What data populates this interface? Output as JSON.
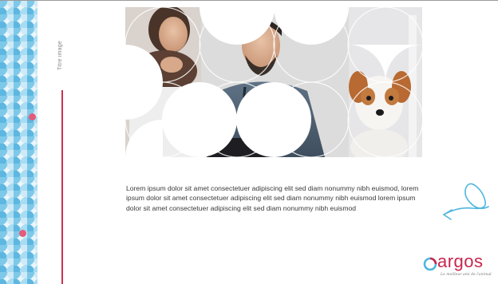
{
  "slide": {
    "image_title_label": "Titre image",
    "body_text": "Lorem ipsum dolor sit amet consectetuer adipiscing elit sed diam nonummy nibh euismod, lorem ipsum dolor sit amet consectetuer adipiscing elit sed diam nonummy nibh euismod lorem ipsum dolor sit amet consectetuer adipiscing elit sed diam nonummy nibh euismod"
  },
  "brand": {
    "name": "argos",
    "tagline": "Le meilleur ami de l'animal",
    "primary_color": "#c7264b",
    "accent_blue": "#4fb6df"
  },
  "decor": {
    "pattern_colors": [
      "#7ec9e9",
      "#a8dcf2",
      "#5db7e0",
      "#e45a7a"
    ],
    "photo_subjects": [
      "veterinarian-woman",
      "veterinarian-man",
      "dog-jack-russell"
    ],
    "icons": [
      "swirl-arrow-icon",
      "argos-logo-icon"
    ]
  }
}
